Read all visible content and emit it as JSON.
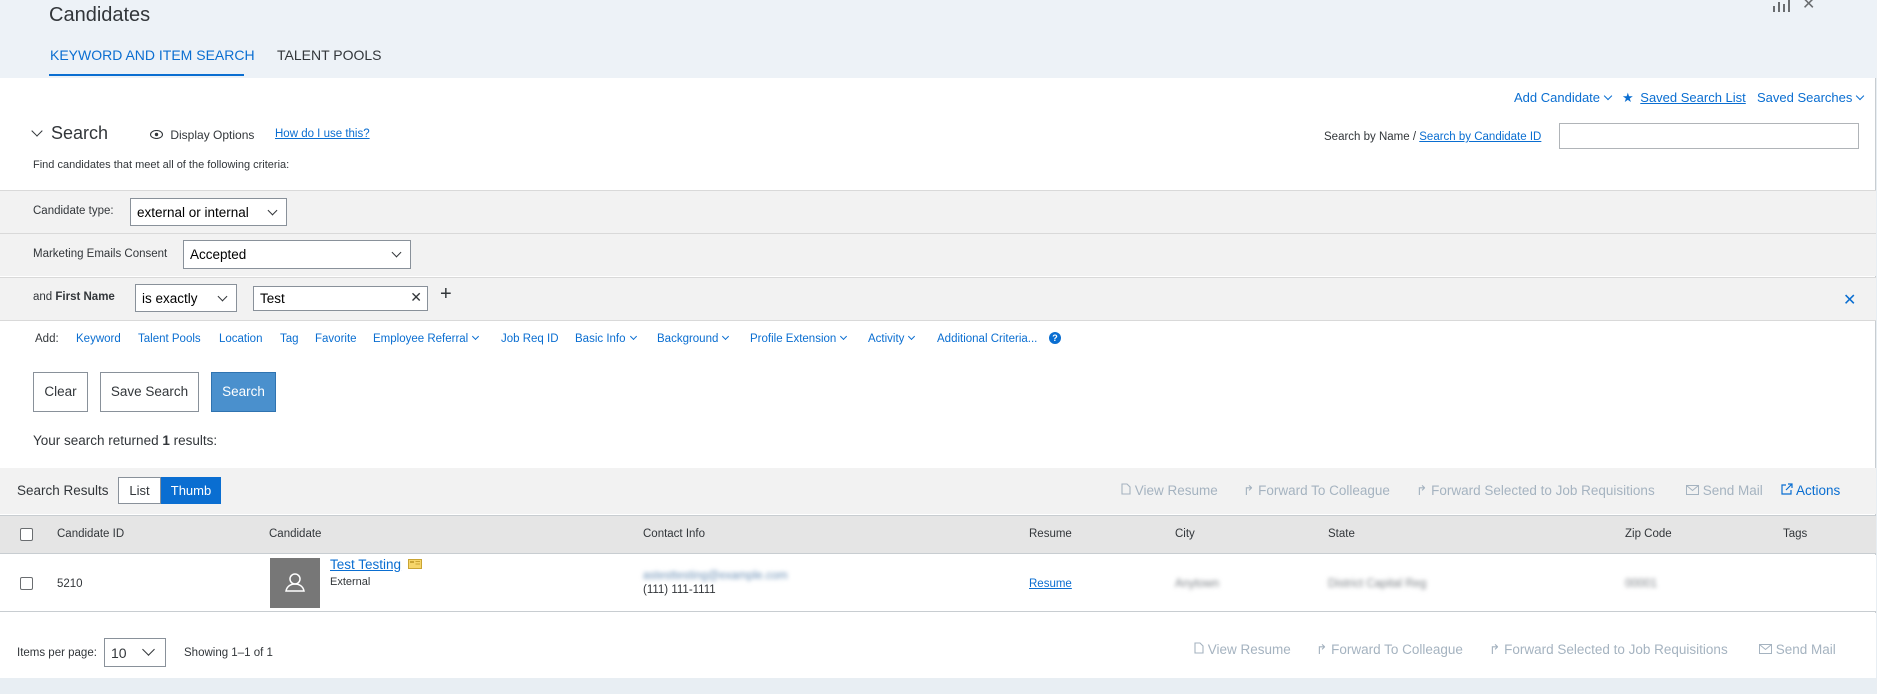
{
  "header": {
    "title": "Candidates",
    "tabs": [
      {
        "label": "KEYWORD AND ITEM SEARCH",
        "active": true
      },
      {
        "label": "TALENT POOLS",
        "active": false
      }
    ]
  },
  "top_links": {
    "add_candidate": "Add Candidate",
    "saved_search_list": "Saved Search List",
    "saved_searches": "Saved Searches"
  },
  "search": {
    "heading": "Search",
    "display_options": "Display Options",
    "how_do": "How do I use this?",
    "find_text": "Find candidates that meet all of the following criteria:",
    "search_by_name": "Search by Name /",
    "search_by_id": "Search by Candidate ID",
    "name_value": ""
  },
  "criteria": {
    "candidate_type_label": "Candidate type:",
    "candidate_type_value": "external or internal",
    "marketing_label": "Marketing Emails Consent",
    "marketing_value": "Accepted",
    "first_name_prefix": "and",
    "first_name_label": "First Name",
    "operator_value": "is exactly",
    "first_name_value": "Test"
  },
  "add_bar": {
    "label": "Add:",
    "links": [
      "Keyword",
      "Talent Pools",
      "Location",
      "Tag",
      "Favorite",
      "Employee Referral",
      "Job Req ID",
      "Basic Info",
      "Background",
      "Profile Extension",
      "Activity",
      "Additional Criteria..."
    ]
  },
  "buttons": {
    "clear": "Clear",
    "save_search": "Save Search",
    "search": "Search"
  },
  "result": {
    "prefix": "Your search returned",
    "count": "1",
    "suffix": "results:"
  },
  "results_bar": {
    "label": "Search Results",
    "list": "List",
    "thumb": "Thumb",
    "actions": {
      "view_resume": "View Resume",
      "forward_colleague": "Forward To Colleague",
      "forward_job": "Forward Selected to Job Requisitions",
      "send_mail": "Send Mail",
      "actions": "Actions"
    }
  },
  "table": {
    "columns": [
      "Candidate ID",
      "Candidate",
      "Contact Info",
      "Resume",
      "City",
      "State",
      "Zip Code",
      "Tags"
    ],
    "rows": [
      {
        "id": "5210",
        "name": "Test Testing",
        "type": "External",
        "email": "astesttesting@example.com",
        "phone": "(111) 111-1111",
        "resume": "Resume",
        "city": "Anytown",
        "state": "District Capital Reg",
        "zip": "00001"
      }
    ]
  },
  "footer": {
    "items_per_page_label": "Items per page:",
    "items_per_page": "10",
    "showing": "Showing 1–1 of 1"
  },
  "colors": {
    "accent": "#0a6ed1",
    "primary_button": "#4a90cd",
    "disabled_action": "#a5b3c0"
  }
}
